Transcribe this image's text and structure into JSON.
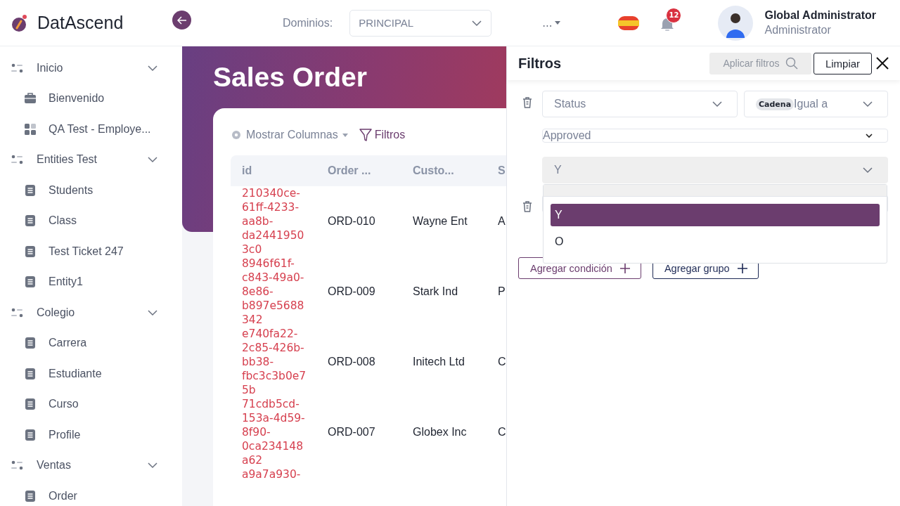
{
  "header": {
    "brand": "DatAscend",
    "domain_label": "Dominios:",
    "domain_select": "PRINCIPAL",
    "more_menu": "...",
    "notifications_count": "12",
    "user": {
      "name": "Global Administrator",
      "role": "Administrator"
    }
  },
  "sidebar": {
    "items": [
      {
        "label": "Inicio",
        "expanded": true,
        "children": [
          {
            "label": "Bienvenido",
            "kind": "welcome"
          },
          {
            "label": "QA Test - Employe...",
            "kind": "dashboard"
          }
        ]
      },
      {
        "label": "Entities Test",
        "expanded": true,
        "children": [
          {
            "label": "Students",
            "kind": "entity"
          },
          {
            "label": "Class",
            "kind": "entity"
          },
          {
            "label": "Test Ticket 247",
            "kind": "entity"
          },
          {
            "label": "Entity1",
            "kind": "entity"
          }
        ]
      },
      {
        "label": "Colegio",
        "expanded": true,
        "children": [
          {
            "label": "Carrera",
            "kind": "entity"
          },
          {
            "label": "Estudiante",
            "kind": "entity"
          },
          {
            "label": "Curso",
            "kind": "entity"
          },
          {
            "label": "Profile",
            "kind": "entity"
          }
        ]
      },
      {
        "label": "Ventas",
        "expanded": true,
        "children": [
          {
            "label": "Order",
            "kind": "entity"
          }
        ]
      }
    ]
  },
  "page": {
    "title": "Sales Order",
    "toolbar": {
      "columns_button": "Mostrar Columnas",
      "filters_button": "Filtros"
    },
    "table": {
      "columns": [
        "id",
        "Order ...",
        "Custo...",
        "S"
      ],
      "rows": [
        [
          "210340ce-61ff-4233-aa8b-da24419503c0",
          "ORD-010",
          "Wayne Ent",
          "A"
        ],
        [
          "8946f61f-c843-49a0-8e86-b897e5688342",
          "ORD-009",
          "Stark Ind",
          "P"
        ],
        [
          "e740fa22-2c85-426b-bb38-fbc3c3b0e75b",
          "ORD-008",
          "Initech Ltd",
          "C"
        ],
        [
          "71cdb5cd-153a-4d59-8f90-0ca234148a62",
          "ORD-007",
          "Globex Inc",
          "C"
        ],
        [
          "a9a7a930-"
        ]
      ]
    }
  },
  "filters_panel": {
    "title": "Filtros",
    "apply_button": {
      "label": "Aplicar filtros",
      "disabled": true
    },
    "clear_button": "Limpiar",
    "conditions": [
      {
        "covered": false,
        "field": "Status",
        "type_badge": "Cadena",
        "operator": "Igual a",
        "value": "Approved"
      },
      {
        "covered": true
      }
    ],
    "logic_select": {
      "value": "Y",
      "disabled": true,
      "expanded": true,
      "options": [
        {
          "label": "Y",
          "selected": true
        },
        {
          "label": "O",
          "selected": false
        }
      ]
    },
    "add_condition_button": "Agregar condición",
    "add_group_button": "Agregar grupo"
  }
}
